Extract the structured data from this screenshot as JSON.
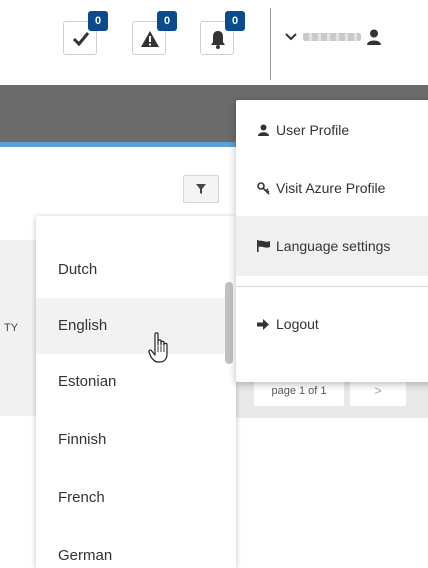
{
  "header": {
    "notifications": [
      {
        "name": "tasks",
        "icon": "check-icon",
        "count": "0"
      },
      {
        "name": "alerts",
        "icon": "warning-icon",
        "count": "0"
      },
      {
        "name": "bell",
        "icon": "bell-icon",
        "count": "0"
      }
    ],
    "user_toggle_icon": "chevron-down-icon",
    "user_icon": "user-icon",
    "badge_color": "#0b4a8c"
  },
  "user_menu": {
    "items": [
      {
        "label": "User Profile",
        "icon": "user-icon"
      },
      {
        "label": "Visit Azure Profile",
        "icon": "key-icon"
      },
      {
        "label": "Language settings",
        "icon": "flag-icon",
        "active": true
      },
      {
        "label": "Logout",
        "icon": "sign-out-icon"
      }
    ]
  },
  "language_dropdown": {
    "items": [
      "Dutch",
      "English",
      "Estonian",
      "Finnish",
      "French",
      "German"
    ],
    "hovered": "English"
  },
  "table": {
    "column_hint": "TY",
    "pager": {
      "text": "page 1 of 1",
      "next_label": ">"
    }
  },
  "colors": {
    "accent_line": "#5b9fd4",
    "band": "#6b6b6b"
  }
}
